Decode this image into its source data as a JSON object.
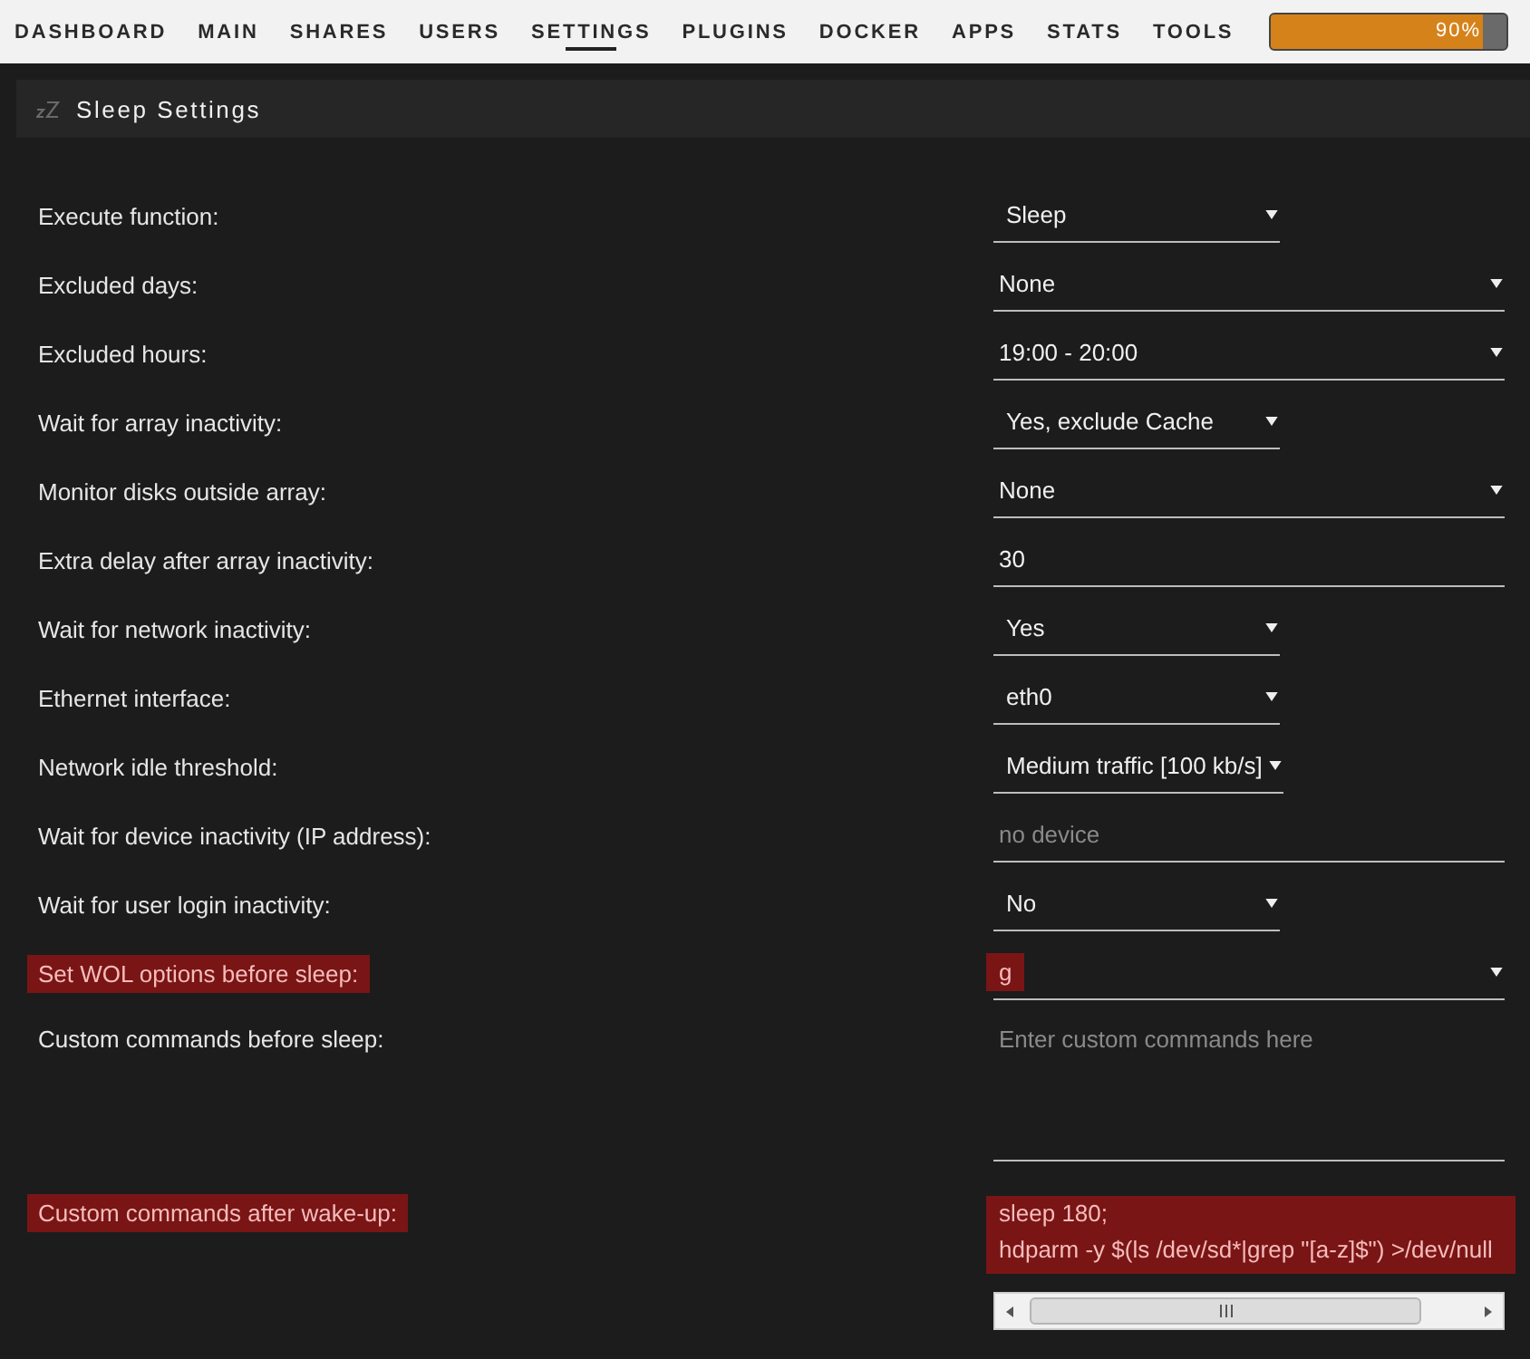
{
  "nav": {
    "tabs": [
      {
        "label": "DASHBOARD",
        "selected": false
      },
      {
        "label": "MAIN",
        "selected": false
      },
      {
        "label": "SHARES",
        "selected": false
      },
      {
        "label": "USERS",
        "selected": false
      },
      {
        "label": "SETTINGS",
        "selected": true
      },
      {
        "label": "PLUGINS",
        "selected": false
      },
      {
        "label": "DOCKER",
        "selected": false
      },
      {
        "label": "APPS",
        "selected": false
      },
      {
        "label": "STATS",
        "selected": false
      },
      {
        "label": "TOOLS",
        "selected": false
      }
    ],
    "usage": {
      "level": 0.9,
      "reading": "90%"
    }
  },
  "panel": {
    "title": "Sleep Settings"
  },
  "settings": [
    {
      "label": "Execute function:",
      "kind": "select",
      "value": "Sleep",
      "highlighted": false
    },
    {
      "label": "Excluded days:",
      "kind": "wideselect",
      "value": "None",
      "highlighted": false
    },
    {
      "label": "Excluded hours:",
      "kind": "wideselect",
      "value": "19:00 - 20:00",
      "highlighted": false
    },
    {
      "label": "Wait for array inactivity:",
      "kind": "select",
      "value": "Yes, exclude Cache",
      "highlighted": false
    },
    {
      "label": "Monitor disks outside array:",
      "kind": "wideselect",
      "value": "None",
      "highlighted": false
    },
    {
      "label": "Extra delay after array inactivity:",
      "kind": "input",
      "value": "30",
      "highlighted": false
    },
    {
      "label": "Wait for network inactivity:",
      "kind": "select",
      "value": "Yes",
      "highlighted": false
    },
    {
      "label": "Ethernet interface:",
      "kind": "select",
      "value": "eth0",
      "highlighted": false
    },
    {
      "label": "Network idle threshold:",
      "kind": "select",
      "value": "Medium traffic [100 kb/s]",
      "highlighted": false
    },
    {
      "label": "Wait for device inactivity (IP address):",
      "kind": "input",
      "placeholder": "no device",
      "highlighted": false
    },
    {
      "label": "Wait for user login inactivity:",
      "kind": "select",
      "value": "No",
      "highlighted": false
    },
    {
      "label": "Set WOL options before sleep:",
      "kind": "wideselect",
      "value": "g",
      "highlighted": true
    },
    {
      "label": "Custom commands before sleep:",
      "kind": "textarea",
      "placeholder": "Enter custom commands here",
      "highlighted": false,
      "h_scrollbar": false
    },
    {
      "label": "Custom commands after wake-up:",
      "kind": "textarea",
      "value": "sleep 180;\nhdparm -y $(ls /dev/sd*|grep \"[a-z]$\") >/dev/null",
      "highlighted": true,
      "h_scrollbar": true
    }
  ]
}
